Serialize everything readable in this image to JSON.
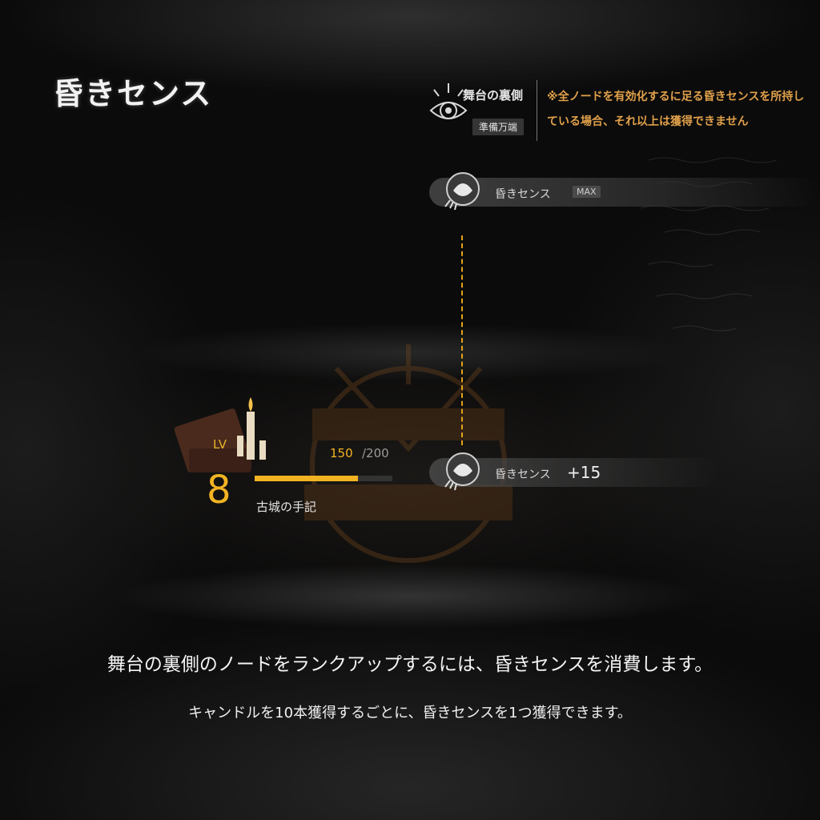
{
  "page": {
    "title": "昏きセンス"
  },
  "header": {
    "stage_name": "舞台の裏側",
    "stage_status": "準備万端",
    "note": "※全ノードを有効化するに足る昏きセンスを所持している場合、それ以上は獲得できません"
  },
  "nodes": [
    {
      "label": "昏きセンス",
      "badge": "MAX"
    },
    {
      "label": "昏きセンス",
      "value": "+15"
    }
  ],
  "level": {
    "lv_label": "LV",
    "level": "8",
    "exp_current": "150",
    "exp_max": "/200",
    "exp_progress": 0.75,
    "item_name": "古城の手記"
  },
  "description": {
    "line1": "舞台の裏側のノードをランクアップするには、昏きセンスを消費します。",
    "line2": "キャンドルを10本獲得するごとに、昏きセンスを1つ獲得できます。"
  },
  "colors": {
    "accent": "#f2b322",
    "note": "#e0a04a",
    "connector": "#e3a21a"
  },
  "icons": [
    "stage-eye-icon",
    "dark-sense-icon",
    "book-candle-icon",
    "crimson-emblem-icon"
  ]
}
